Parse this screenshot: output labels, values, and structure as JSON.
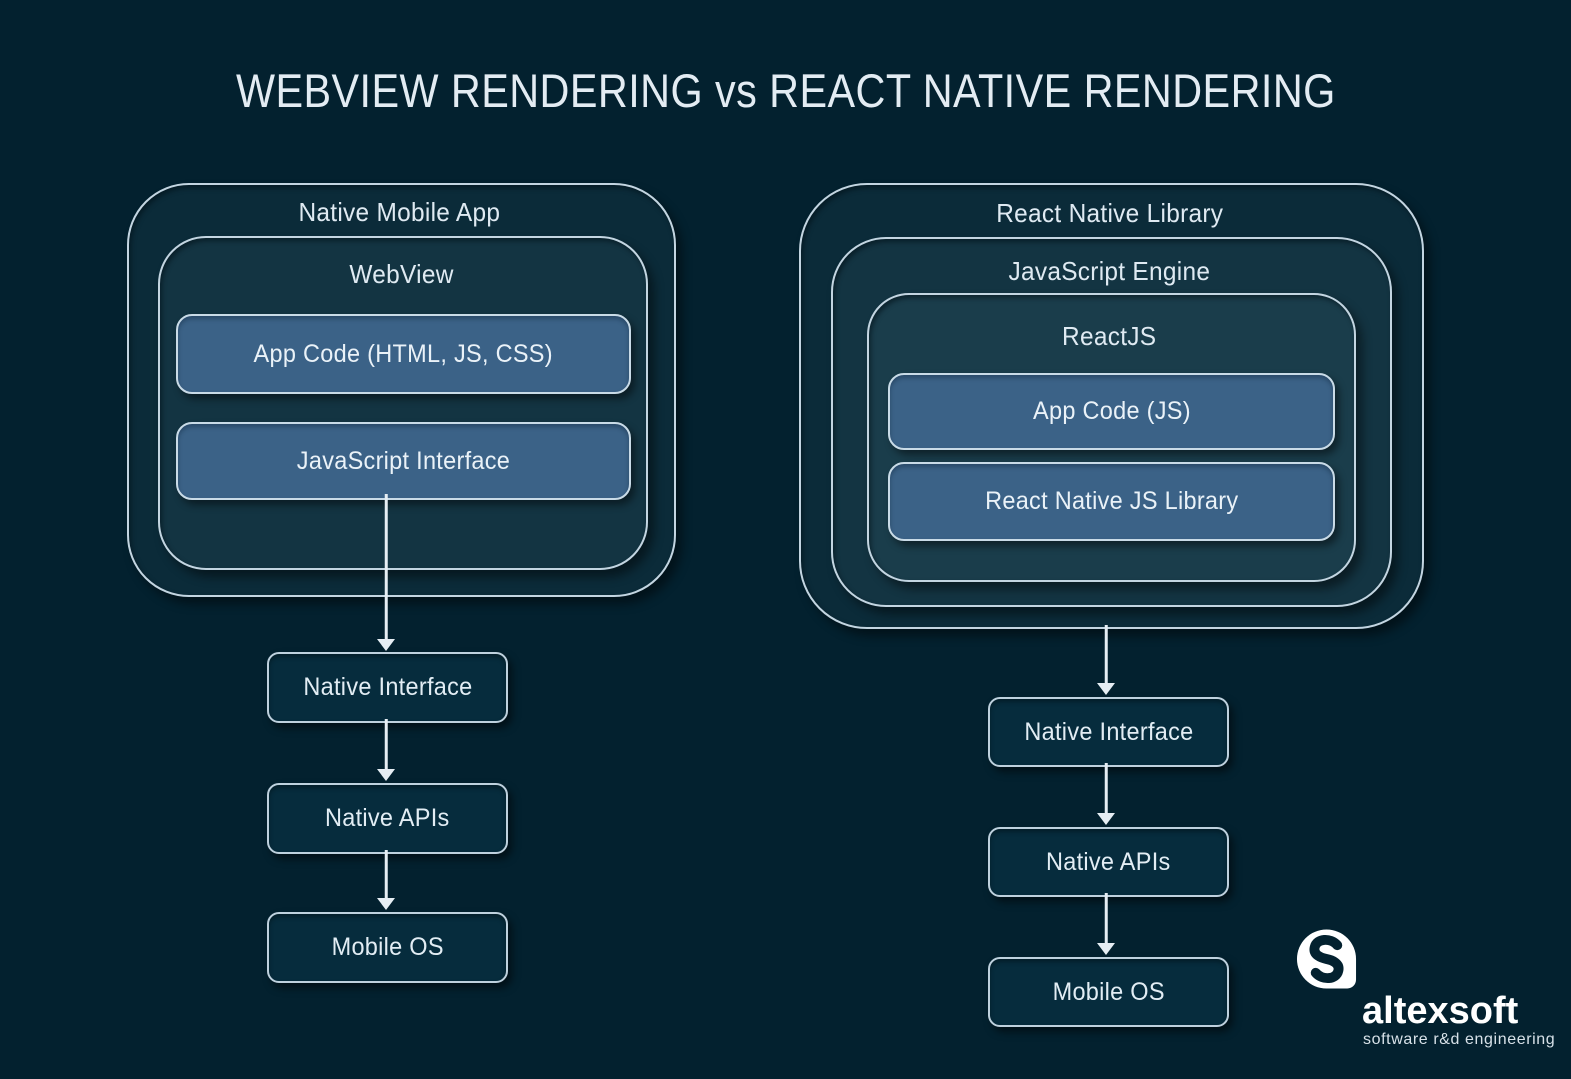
{
  "title": "WEBVIEW RENDERING vs REACT NATIVE RENDERING",
  "left": {
    "outer_label": "Native Mobile App",
    "inner_label": "WebView",
    "boxes": [
      "App Code (HTML, JS, CSS)",
      "JavaScript Interface"
    ],
    "flow": [
      "Native Interface",
      "Native APIs",
      "Mobile OS"
    ]
  },
  "right": {
    "outer_label": "React Native Library",
    "middle_label": "JavaScript Engine",
    "inner_label": "ReactJS",
    "boxes": [
      "App Code (JS)",
      "React Native JS Library"
    ],
    "flow": [
      "Native Interface",
      "Native APIs",
      "Mobile OS"
    ]
  },
  "logo": {
    "icon": "altexsoft-logo-icon",
    "name": "altexsoft",
    "tagline": "software r&d engineering"
  },
  "colors": {
    "background": "#03212f",
    "accent_box_fill": "#3b6287",
    "outline": "#c3d5e1",
    "dark_box_fill": "#062c3d",
    "text": "#e6eef4"
  }
}
